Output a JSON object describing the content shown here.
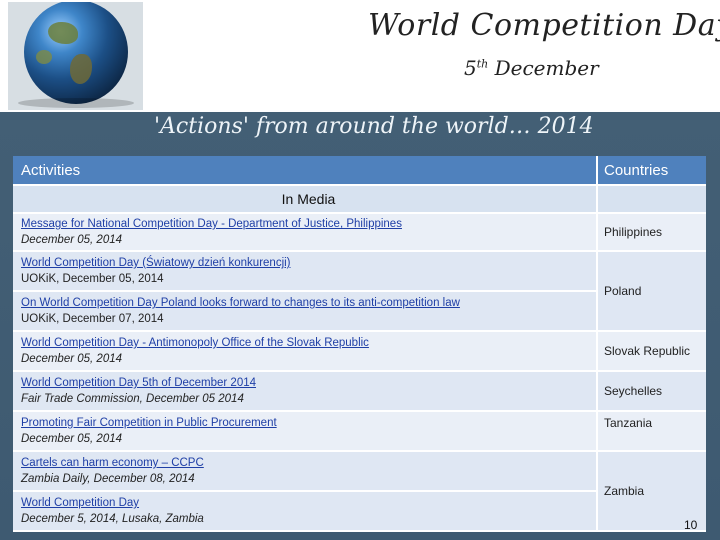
{
  "header": {
    "title": "World Competition Day",
    "date_day": "5",
    "date_suffix": "th",
    "date_month": "December",
    "subtitle": "'Actions' from around the world… 2014"
  },
  "table": {
    "col_activities": "Activities",
    "col_countries": "Countries",
    "section": "In Media",
    "rows": [
      {
        "link": "Message for National Competition Day - Department of Justice, Philippines",
        "source": "December 05, 2014"
      },
      {
        "link": "World Competition Day (Światowy dzień konkurencji)",
        "source": "UOKiK, December 05, 2014"
      },
      {
        "link": "On World Competition Day Poland looks forward to changes to its anti-competition law",
        "source": "UOKiK, December 07, 2014"
      },
      {
        "link": "World Competition Day - Antimonopoly Office of the Slovak Republic",
        "source": "December 05, 2014"
      },
      {
        "link": "World Competition Day 5th of December 2014",
        "source": "Fair Trade Commission, December 05 2014"
      },
      {
        "link": "Promoting Fair Competition in Public Procurement",
        "source": "December 05, 2014"
      },
      {
        "link": "Cartels can harm economy – CCPC",
        "source": "Zambia Daily, December 08, 2014"
      },
      {
        "link": "World Competition Day",
        "source": "December 5, 2014, Lusaka, Zambia"
      }
    ],
    "countries": [
      "Philippines",
      "Poland",
      "Slovak Republic",
      "Seychelles",
      "Tanzania",
      "Zambia"
    ]
  },
  "page_number": "10"
}
